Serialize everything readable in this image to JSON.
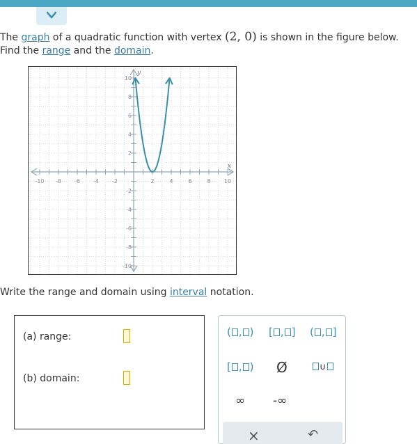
{
  "question": {
    "line1": {
      "t1": "The ",
      "graph_link": "graph",
      "t2": " of a quadratic function with vertex ",
      "vertex": "(2, 0)",
      "t3": " is shown in the figure below."
    },
    "line2": {
      "t1": "Find the ",
      "range_link": "range",
      "t2": " and the ",
      "domain_link": "domain",
      "t3": "."
    },
    "instruction": {
      "t1": "Write the range and domain using ",
      "interval_link": "interval",
      "t2": " notation."
    }
  },
  "graph": {
    "x_label": "x",
    "y_label": "y",
    "x_ticks": [
      "-10",
      "-8",
      "-6",
      "-4",
      "-2",
      "2",
      "4",
      "6",
      "8",
      "10"
    ],
    "y_ticks": [
      "10",
      "8",
      "6",
      "4",
      "2",
      "-2",
      "-4",
      "-6",
      "-8",
      "-10"
    ],
    "curve_color": "#3a8fa8",
    "vertex_point": {
      "x": 2,
      "y": 0
    },
    "function": "y = 3(x - 2)^2"
  },
  "answers": {
    "range_label": "(a)  range:",
    "domain_label": "(b)  domain:"
  },
  "palette": {
    "infinity": "∞",
    "neg_infinity": "-∞",
    "empty_set": "Ø",
    "clear": "×",
    "undo": "↶"
  },
  "colors": {
    "accent_bar": "#4aa8c4",
    "link": "#3a7ea0",
    "palette_blue": "#3a8fb0",
    "input_border": "#d8b200"
  }
}
